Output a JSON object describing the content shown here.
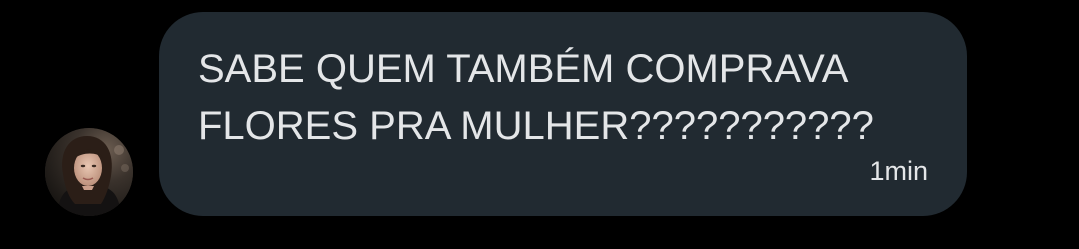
{
  "message": {
    "text": "SABE QUEM TAMBÉM COMPRAVA FLORES PRA MULHER???????????",
    "timestamp": "1min"
  },
  "sender": {
    "avatar_icon": "profile-photo"
  },
  "colors": {
    "background": "#000000",
    "bubble": "#212a31",
    "text": "#e4e6e8"
  }
}
